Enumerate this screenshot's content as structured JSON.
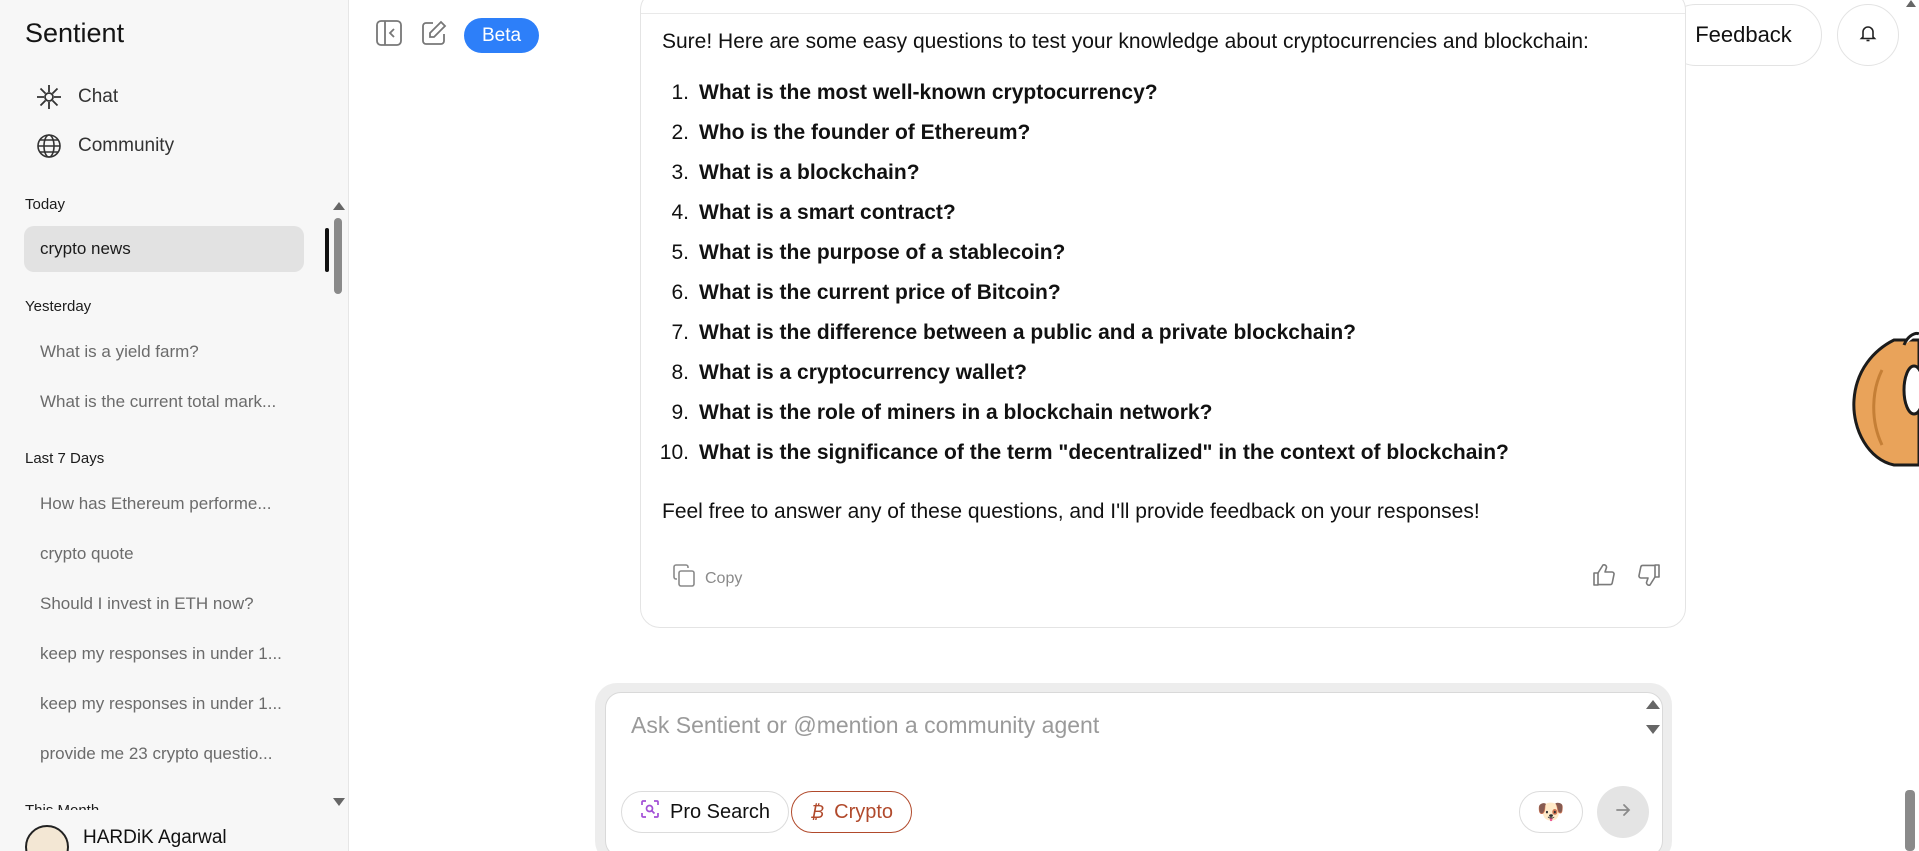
{
  "app": {
    "name": "Sentient"
  },
  "nav": {
    "chat": "Chat",
    "community": "Community"
  },
  "history": {
    "sections": [
      {
        "label": "Today",
        "items": [
          "crypto news"
        ]
      },
      {
        "label": "Yesterday",
        "items": [
          "What is a yield farm?",
          "What is the current total mark..."
        ]
      },
      {
        "label": "Last 7 Days",
        "items": [
          "How has Ethereum performe...",
          "crypto quote",
          "Should I invest in ETH now?",
          "keep my responses in under 1...",
          "keep my responses in under 1...",
          "provide me 23 crypto questio..."
        ]
      },
      {
        "label": "This Month",
        "items": []
      }
    ],
    "active_item": "crypto news"
  },
  "user": {
    "name": "HARDiK Agarwal"
  },
  "topbar": {
    "beta_label": "Beta",
    "feedback_label": "Feedback"
  },
  "message": {
    "intro": "Sure! Here are some easy questions to test your knowledge about cryptocurrencies and blockchain:",
    "questions": [
      "What is the most well-known cryptocurrency?",
      "Who is the founder of Ethereum?",
      "What is a blockchain?",
      "What is a smart contract?",
      "What is the purpose of a stablecoin?",
      "What is the current price of Bitcoin?",
      "What is the difference between a public and a private blockchain?",
      "What is a cryptocurrency wallet?",
      "What is the role of miners in a blockchain network?",
      "What is the significance of the term \"decentralized\" in the context of blockchain?"
    ],
    "outro": "Feel free to answer any of these questions, and I'll provide feedback on your responses!",
    "copy_label": "Copy"
  },
  "composer": {
    "placeholder": "Ask Sentient or @mention a community agent",
    "pro_search_label": "Pro Search",
    "crypto_label": "Crypto"
  },
  "colors": {
    "accent": "#2d7ff9",
    "crypto": "#b14a2c",
    "sidebar_bg": "#f7f7f7",
    "active_item_bg": "#e2e2e2"
  },
  "icons": {
    "chat": "sentient-logo-icon",
    "community": "globe-icon",
    "collapse": "sidebar-collapse-icon",
    "new_chat": "edit-icon",
    "bell": "bell-icon",
    "copy": "copy-icon",
    "like": "thumbs-up-icon",
    "dislike": "thumbs-down-icon",
    "pro_search": "scan-search-icon",
    "crypto": "bitcoin-icon",
    "send": "arrow-right-icon"
  }
}
